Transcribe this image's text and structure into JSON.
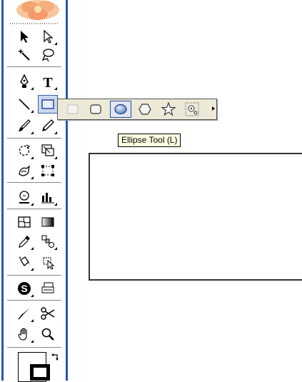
{
  "tooltip": {
    "text": "Ellipse Tool (L)"
  },
  "active_tool": "rectangle-tool",
  "flyout": {
    "selected": "ellipse-tool",
    "tools": [
      "rectangle-tool",
      "rounded-rectangle-tool",
      "ellipse-tool",
      "polygon-tool",
      "star-tool",
      "flare-tool"
    ]
  },
  "colors": {
    "toolbox_edge": "#2f54a8",
    "flyout_bg": "#ece9d8",
    "tooltip_bg": "#ffffe1",
    "selection": "#2b4b9a"
  }
}
